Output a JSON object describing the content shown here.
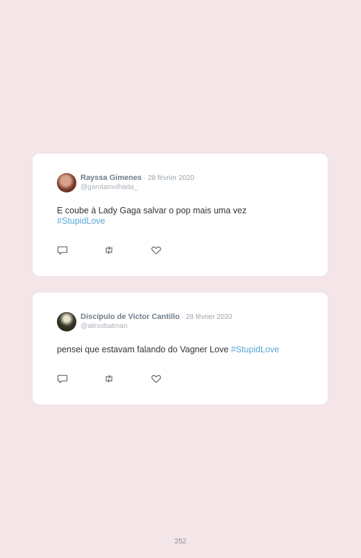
{
  "tweets": [
    {
      "author_name": "Rayssa Gimenes",
      "date": " · 28 février 2020",
      "handle": "@garotamolhada_",
      "text": "E coube à Lady Gaga salvar o pop mais uma vez",
      "hashtag": "#StupidLove",
      "avatar": "avatar-photo"
    },
    {
      "author_name": "Discípulo de Victor Cantillo",
      "date": " · 28 février 2020",
      "handle": "@alexobatman",
      "text": "pensei que estavam falando do Vagner Love ",
      "hashtag": "#StupidLove",
      "avatar": "avatar-photo"
    }
  ],
  "icons": {
    "reply": "reply-icon",
    "retweet": "retweet-icon",
    "like": "heart-icon"
  },
  "colors": {
    "background": "#f4e5e9",
    "card": "#ffffff",
    "hashtag": "#5aa7d6",
    "name": "#6f7d8a"
  },
  "page_number": "252"
}
